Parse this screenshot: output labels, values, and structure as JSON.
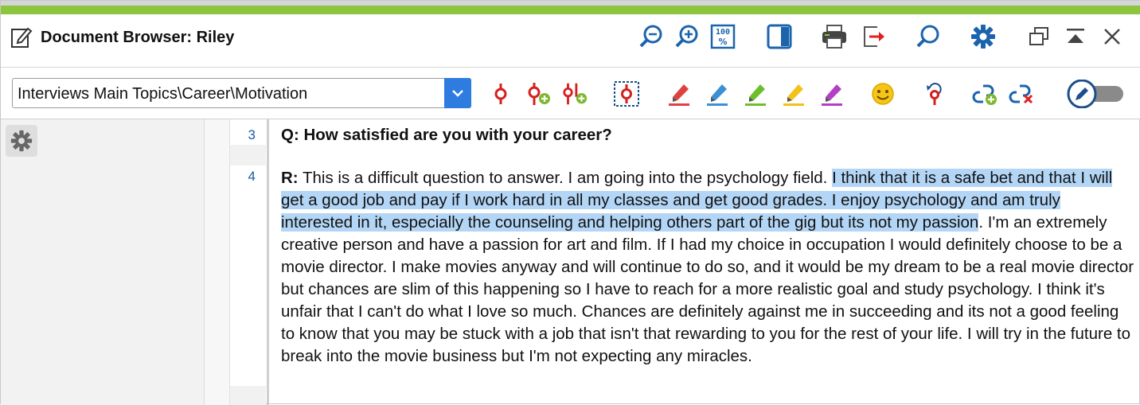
{
  "window": {
    "title": "Document Browser: Riley",
    "accent_color": "#8cc63f"
  },
  "title_icons": [
    "zoom-out-icon",
    "zoom-in-icon",
    "zoom-percent-icon",
    "panel-toggle-icon",
    "print-icon",
    "export-icon",
    "search-icon",
    "settings-icon",
    "undock-icon",
    "collapse-icon",
    "close-icon"
  ],
  "code_selector": {
    "value": "Interviews Main Topics\\Career\\Motivation"
  },
  "toolbar_icons": [
    "code-selection-icon",
    "code-new-code-icon",
    "code-add-icon",
    "code-in-vivo-icon",
    "highlight-red-icon",
    "highlight-blue-icon",
    "highlight-green-icon",
    "highlight-yellow-icon",
    "highlight-purple-icon",
    "emoticode-icon",
    "undo-code-icon",
    "add-link-icon",
    "remove-link-icon",
    "edit-mode-toggle"
  ],
  "document": {
    "line_numbers": [
      "3",
      "4"
    ],
    "question": "Q: How satisfied are you with your career?",
    "response_label": "R:",
    "response_before": " This is a difficult question to answer. I am going into the psychology field. ",
    "response_highlighted": "I think that it is a safe bet and that I will get a good job and pay if I work hard in all my classes and get good grades. I enjoy psychology and am truly interested in it, especially the counseling and helping others part of the gig but its not my passion",
    "response_after": ". I'm an extremely creative person and have a passion for art and film. If I had my choice in occupation I would definitely choose to be a movie director. I make movies anyway and will continue to do so, and it would be my dream to be a real movie director but chances are slim of this happening so I have to reach for a more realistic goal and study psychology. I think it's unfair that I can't do what I love so much. Chances are definitely against me in succeeding and its not a good feeling to know that you may be stuck with a job that isn't that rewarding to you for the rest of your life. I will try in the future to break into the movie business but I'm not expecting any miracles.",
    "highlight_color": "#b4d6f6"
  }
}
